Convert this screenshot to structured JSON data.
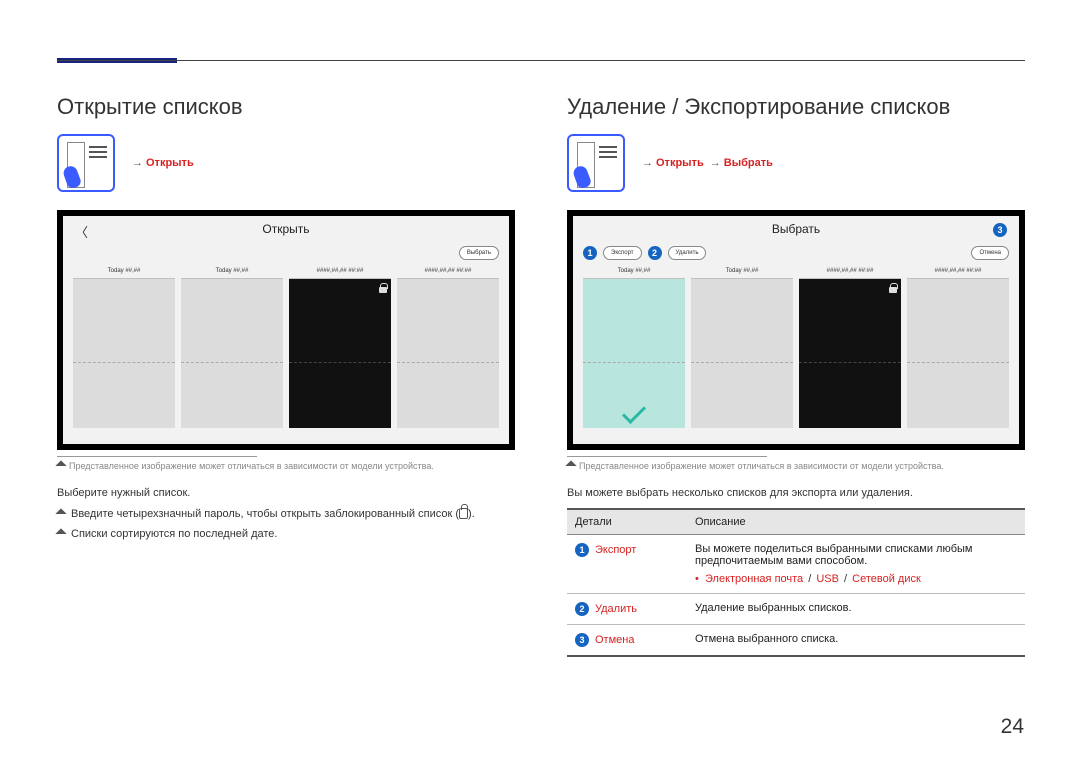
{
  "page_number": "24",
  "left": {
    "title": "Открытие списков",
    "crumb_open": "Открыть",
    "shot": {
      "title": "Открыть",
      "select_btn": "Выбрать",
      "thumbs": [
        "Today ##,##",
        "Today ##,##",
        "####,##,## ##:##",
        "####,##,## ##:##"
      ]
    },
    "caption": "Представленное изображение может отличаться в зависимости от модели устройства.",
    "line1": "Выберите нужный список.",
    "line2": "Введите четырехзначный пароль, чтобы открыть заблокированный список (",
    "line2_tail": ").",
    "line3": "Списки сортируются по последней дате."
  },
  "right": {
    "title": "Удаление / Экспортирование списков",
    "crumb_open": "Открыть",
    "crumb_select": "Выбрать",
    "shot": {
      "title": "Выбрать",
      "export_btn": "Экспорт",
      "delete_btn": "Удалить",
      "cancel_btn": "Отмена",
      "thumbs": [
        "Today ##,##",
        "Today ##,##",
        "####,##,## ##:##",
        "####,##,## ##:##"
      ]
    },
    "caption": "Представленное изображение может отличаться в зависимости от модели устройства.",
    "intro": "Вы можете выбрать несколько списков для экспорта или удаления.",
    "th1": "Детали",
    "th2": "Описание",
    "r1_label": "Экспорт",
    "r1_desc": "Вы можете поделиться выбранными списками любым предпочитаемым вами способом.",
    "r1_sub_a": "Электронная почта",
    "r1_sub_b": "USB",
    "r1_sub_c": "Сетевой диск",
    "r2_label": "Удалить",
    "r2_desc": "Удаление выбранных списков.",
    "r3_label": "Отмена",
    "r3_desc": "Отмена выбранного списка."
  }
}
